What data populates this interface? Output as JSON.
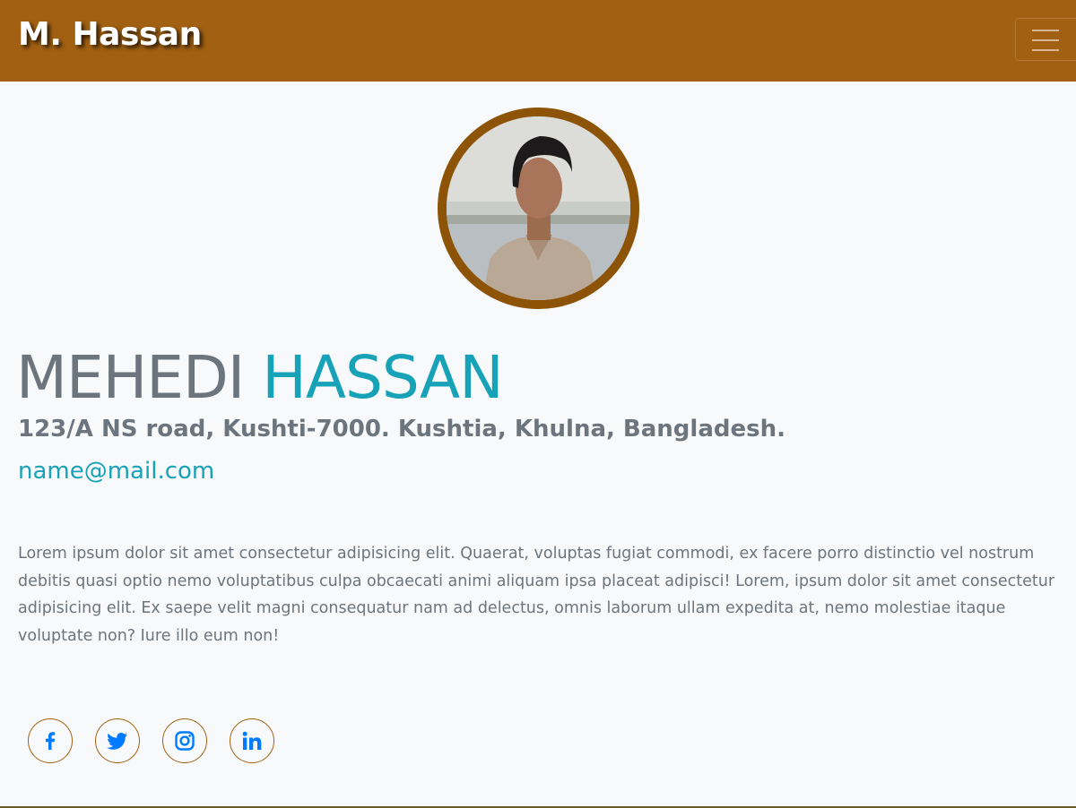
{
  "navbar": {
    "brand": "M. Hassan",
    "background_color": "#a26112",
    "menu_icon": "hamburger-menu-icon"
  },
  "profile": {
    "photo_border_color": "#8d5408",
    "first_name": "MEHEDI",
    "last_name": "HASSAN",
    "address": "123/A NS road, Kushti-7000. Kushtia, Khulna, Bangladesh.",
    "email": "name@mail.com",
    "bio": "Lorem ipsum dolor sit amet consectetur adipisicing elit. Quaerat, voluptas fugiat commodi, ex facere porro distinctio vel nostrum debitis quasi optio nemo voluptatibus culpa obcaecati animi aliquam ipsa placeat adipisci! Lorem, ipsum dolor sit amet consectetur adipisicing elit. Ex saepe velit magni consequatur nam ad delectus, omnis laborum ullam expedita at, nemo molestiae itaque voluptate non? Iure illo eum non!"
  },
  "social": [
    {
      "name": "facebook",
      "icon": "facebook-icon"
    },
    {
      "name": "twitter",
      "icon": "twitter-icon"
    },
    {
      "name": "instagram",
      "icon": "instagram-icon"
    },
    {
      "name": "linkedin",
      "icon": "linkedin-icon"
    }
  ],
  "colors": {
    "accent": "#17a2b8",
    "muted_text": "#6c757d",
    "social_icon": "#007bff",
    "page_background": "#f8f9fa"
  }
}
